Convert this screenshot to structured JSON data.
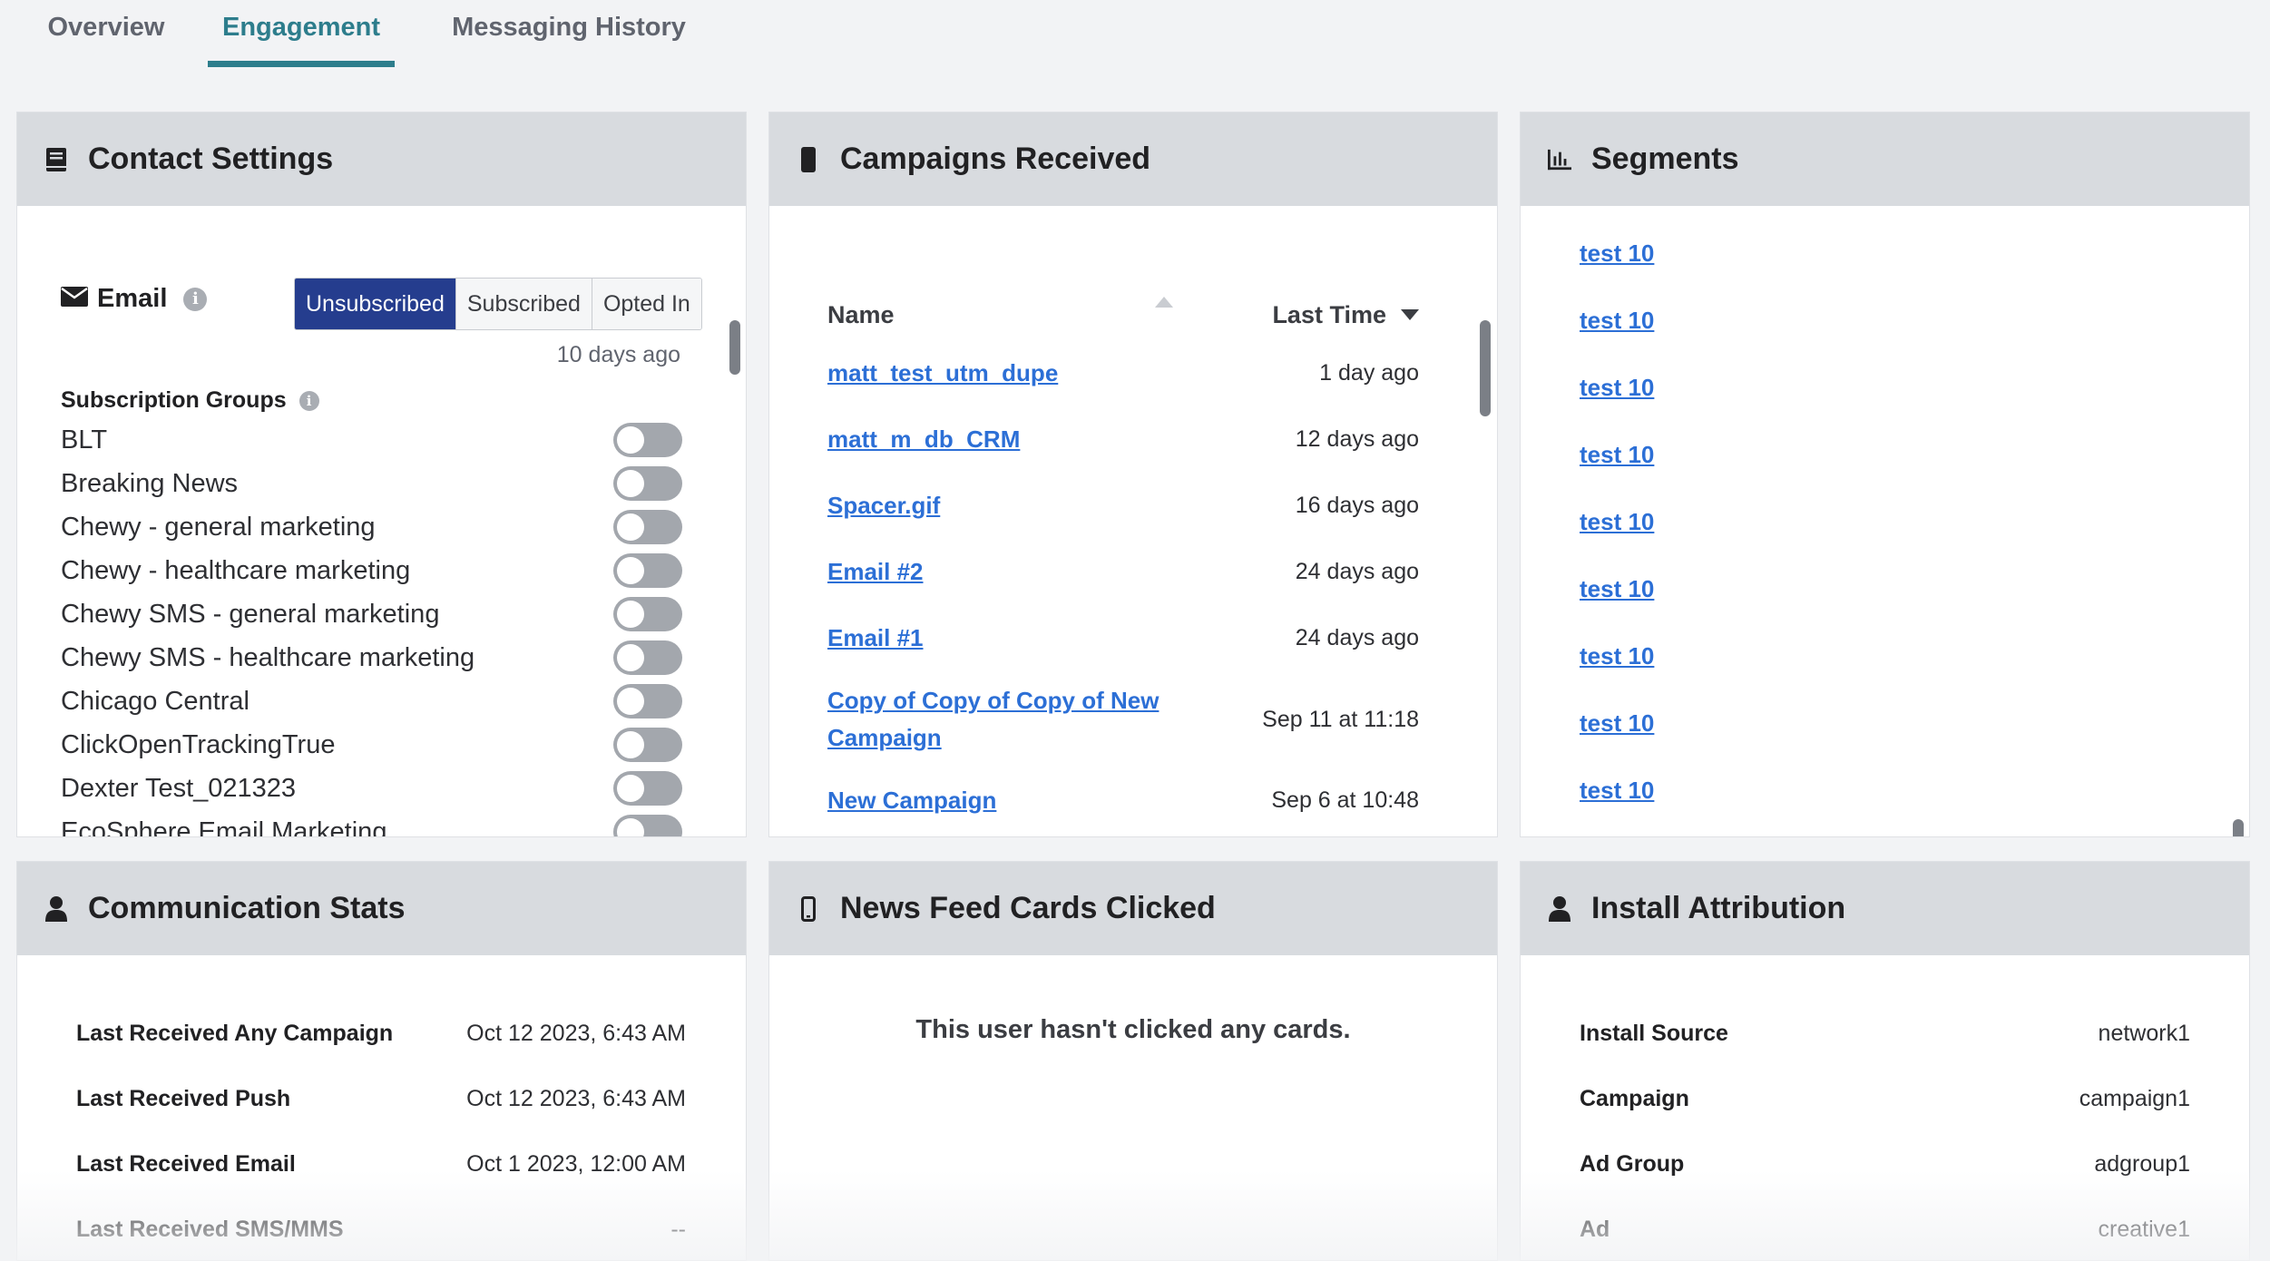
{
  "tabs": [
    {
      "label": "Overview",
      "active": false
    },
    {
      "label": "Engagement",
      "active": true
    },
    {
      "label": "Messaging History",
      "active": false
    }
  ],
  "colors": {
    "accent": "#2d7d8c",
    "selected": "#253d8e",
    "link": "#2c6fd6"
  },
  "contact_settings": {
    "title": "Contact Settings",
    "icon": "book-icon",
    "email_label": "Email",
    "email_options": [
      "Unsubscribed",
      "Subscribed",
      "Opted In"
    ],
    "email_selected": "Unsubscribed",
    "email_updated": "10 days ago",
    "groups_title": "Subscription Groups",
    "groups": [
      {
        "name": "BLT",
        "enabled": false
      },
      {
        "name": "Breaking News",
        "enabled": false
      },
      {
        "name": "Chewy - general marketing",
        "enabled": false
      },
      {
        "name": "Chewy - healthcare marketing",
        "enabled": false
      },
      {
        "name": "Chewy SMS - general marketing",
        "enabled": false
      },
      {
        "name": "Chewy SMS - healthcare marketing",
        "enabled": false
      },
      {
        "name": "Chicago Central",
        "enabled": false
      },
      {
        "name": "ClickOpenTrackingTrue",
        "enabled": false
      },
      {
        "name": "Dexter Test_021323",
        "enabled": false
      },
      {
        "name": "EcoSphere Email Marketing",
        "enabled": false
      }
    ]
  },
  "campaigns": {
    "title": "Campaigns Received",
    "icon": "phone-icon",
    "col_name": "Name",
    "col_time": "Last Time",
    "rows": [
      {
        "name": "matt_test_utm_dupe",
        "time": "1 day ago"
      },
      {
        "name": "matt_m_db_CRM",
        "time": "12 days ago"
      },
      {
        "name": "Spacer.gif",
        "time": "16 days ago"
      },
      {
        "name": "Email #2",
        "time": "24 days ago"
      },
      {
        "name": "Email #1",
        "time": "24 days ago"
      },
      {
        "name": "Copy of Copy of Copy of New Campaign",
        "time": "Sep 11 at 11:18"
      },
      {
        "name": "New Campaign",
        "time": "Sep 6 at 10:48"
      }
    ]
  },
  "segments": {
    "title": "Segments",
    "icon": "bar-chart-icon",
    "items": [
      "test 10",
      "test 10",
      "test 10",
      "test 10",
      "test 10",
      "test 10",
      "test 10",
      "test 10",
      "test 10"
    ]
  },
  "communication_stats": {
    "title": "Communication Stats",
    "icon": "person-icon",
    "rows": [
      {
        "label": "Last Received Any Campaign",
        "value": "Oct 12 2023, 6:43 AM"
      },
      {
        "label": "Last Received Push",
        "value": "Oct 12 2023, 6:43 AM"
      },
      {
        "label": "Last Received Email",
        "value": "Oct 1 2023, 12:00 AM"
      },
      {
        "label": "Last Received SMS/MMS",
        "value": "--"
      }
    ]
  },
  "news_feed": {
    "title": "News Feed Cards Clicked",
    "icon": "mobile-icon",
    "empty": "This user hasn't clicked any cards."
  },
  "install_attribution": {
    "title": "Install Attribution",
    "icon": "person-icon",
    "rows": [
      {
        "label": "Install Source",
        "value": "network1"
      },
      {
        "label": "Campaign",
        "value": "campaign1"
      },
      {
        "label": "Ad Group",
        "value": "adgroup1"
      },
      {
        "label": "Ad",
        "value": "creative1"
      }
    ]
  }
}
